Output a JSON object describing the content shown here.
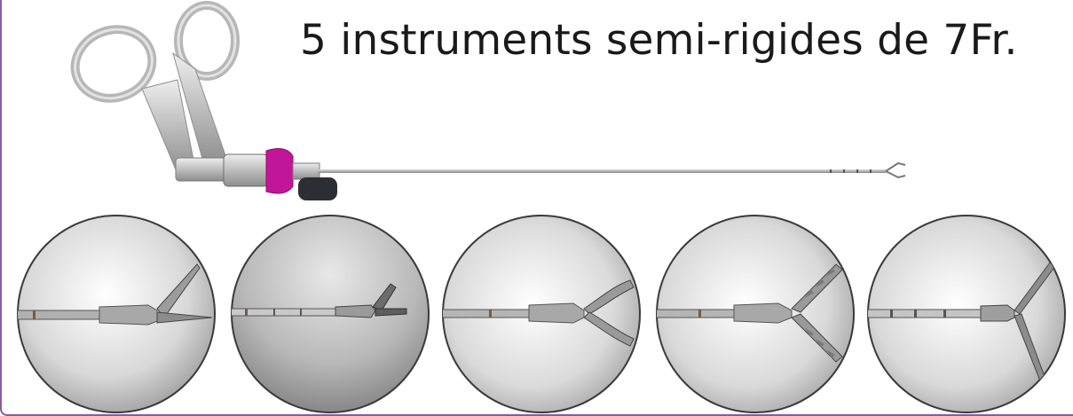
{
  "title": "5 instruments semi-rigides de 7Fr.",
  "colors": {
    "frame": "#8a5aa0",
    "handle_metal": "#c9c9c9",
    "port_magenta": "#c2169a",
    "cap_dark": "#2b2e33"
  },
  "tips": [
    {
      "icon": "scissors-straight-tip-icon"
    },
    {
      "icon": "scissors-hook-tip-icon"
    },
    {
      "icon": "grasper-curved-jaws-icon"
    },
    {
      "icon": "toothed-forceps-tip-icon"
    },
    {
      "icon": "grasper-open-jaws-icon"
    }
  ]
}
